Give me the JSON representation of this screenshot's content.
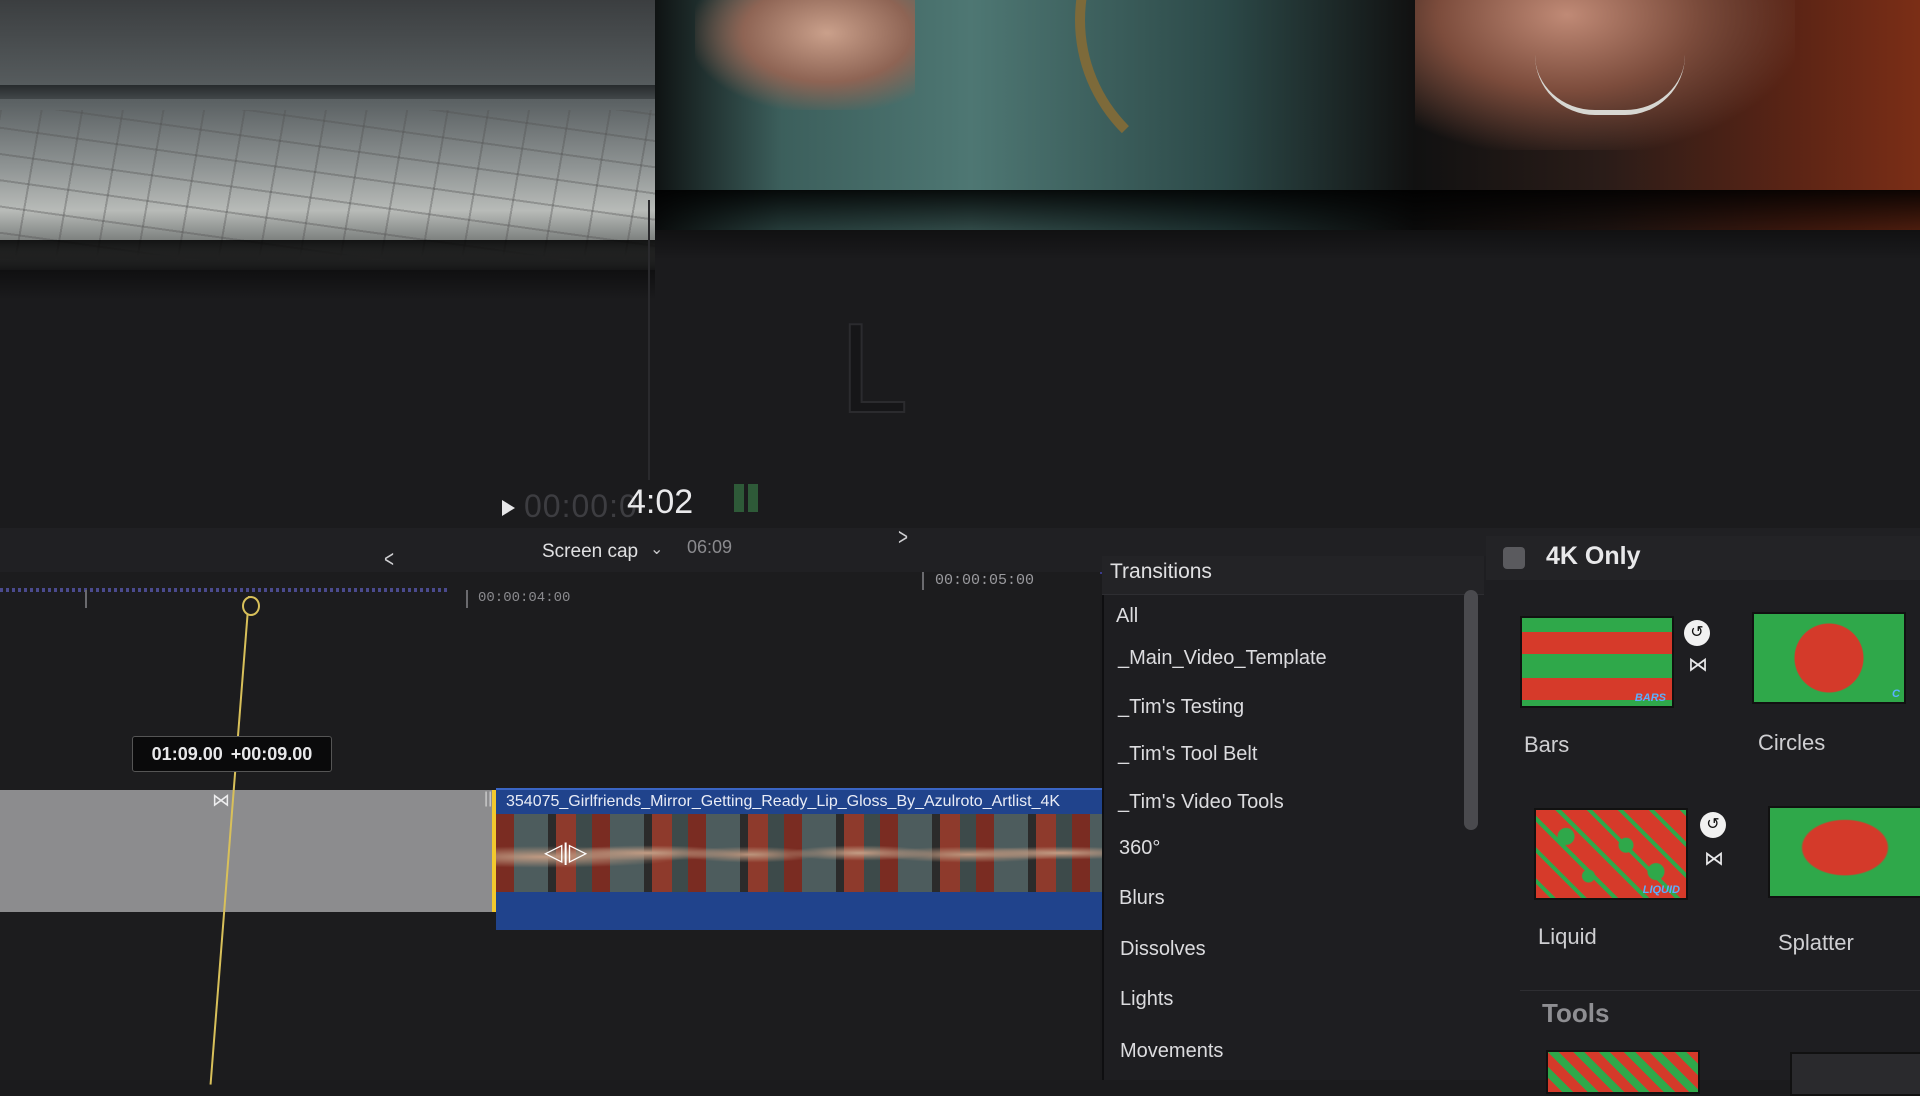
{
  "viewer": {
    "letter": "L",
    "timecode_dim": "00:00:0",
    "timecode_main": "4:02"
  },
  "timeline_bar": {
    "back": "<",
    "forward": ">",
    "project_name": "Screen cap",
    "project_chevron": "⌄",
    "project_duration": "06:09"
  },
  "ruler": {
    "label_1": "00:00:04:00",
    "label_2": "00:00:05:00"
  },
  "skimmer": {
    "timecode": "01:09.00",
    "delta": "+00:09.00"
  },
  "gap_clip": {
    "handle": "⋈",
    "marks": "||"
  },
  "video_clip": {
    "name": "354075_Girlfriends_Mirror_Getting_Ready_Lip_Gloss_By_Azulroto_Artlist_4K",
    "trim_icon": "◁|▷"
  },
  "browser": {
    "title": "Transitions",
    "categories": [
      "All",
      "_Main_Video_Template",
      "_Tim's Testing",
      "_Tim's Tool Belt",
      "_Tim's Video Tools",
      "360°",
      "Blurs",
      "Dissolves",
      "Lights",
      "Movements"
    ],
    "filter_label": "4K Only",
    "tiles": [
      {
        "label": "Bars",
        "tag": "BARS"
      },
      {
        "label": "Circles",
        "tag": "C"
      },
      {
        "label": "Liquid",
        "tag": "LIQUID"
      },
      {
        "label": "Splatter",
        "tag": ""
      }
    ],
    "section_tools": "Tools",
    "badge_glyph": "↺",
    "bowtie_glyph": "⋈"
  },
  "colors": {
    "accent": "#3a3a8a",
    "playhead": "#d8c05a",
    "clip_blue": "#20438c",
    "selection_yellow": "#f2c92e"
  }
}
